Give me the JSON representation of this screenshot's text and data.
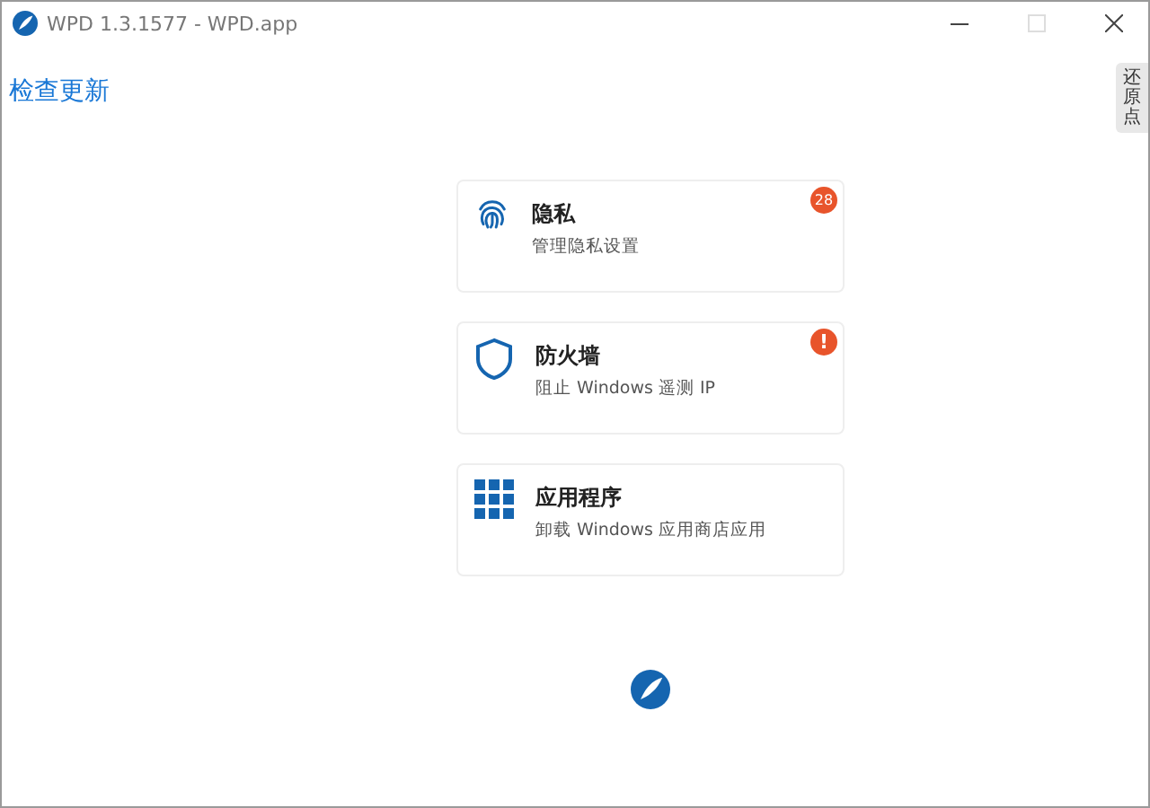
{
  "window": {
    "title": "WPD 1.3.1577 - WPD.app"
  },
  "update_link": "检查更新",
  "side_tab": "还原点",
  "cards": [
    {
      "kind": "privacy",
      "title": "隐私",
      "subtitle": "管理隐私设置",
      "badge": {
        "kind": "count",
        "text": "28"
      }
    },
    {
      "kind": "firewall",
      "title": "防火墙",
      "subtitle": "阻止 Windows 遥测 IP",
      "badge": {
        "kind": "alert",
        "text": "!"
      }
    },
    {
      "kind": "apps",
      "title": "应用程序",
      "subtitle": "卸载 Windows 应用商店应用"
    }
  ]
}
